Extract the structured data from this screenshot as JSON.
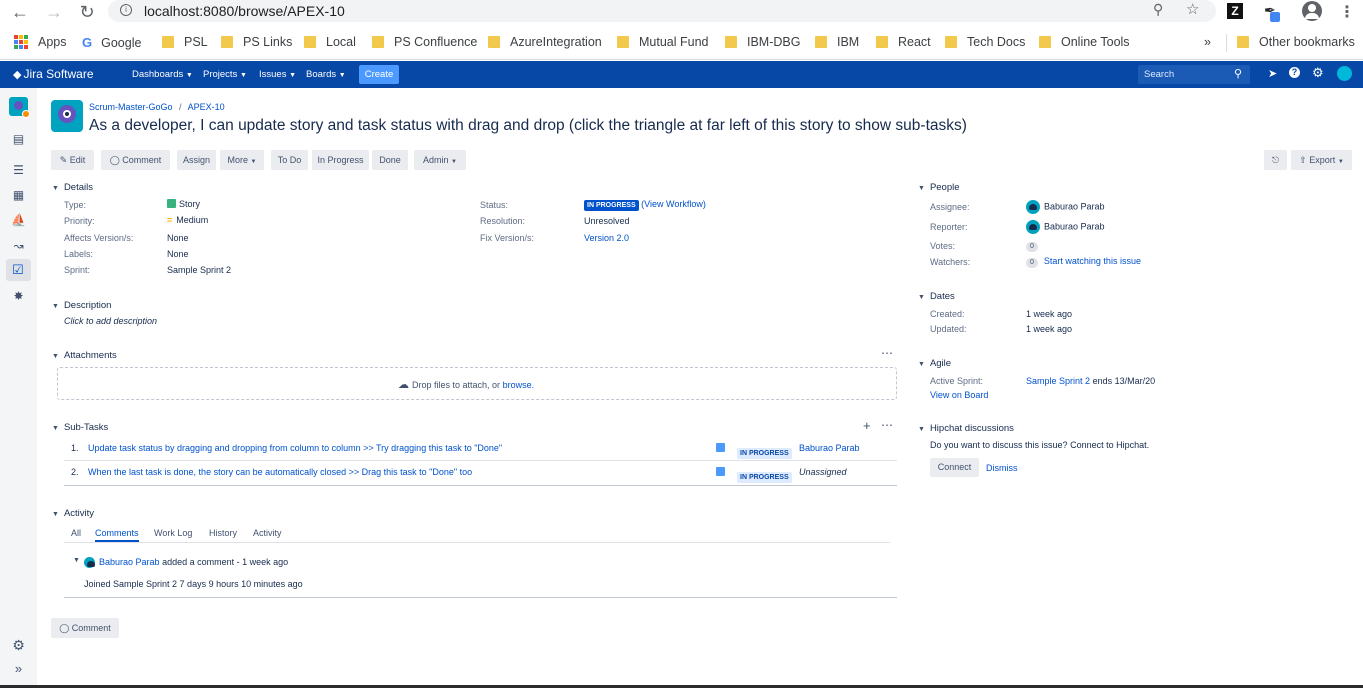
{
  "browser": {
    "url": "localhost:8080/browse/APEX-10",
    "bookmarks": [
      "Apps",
      "Google",
      "PSL",
      "PS Links",
      "Local",
      "PS Confluence",
      "AzureIntegration",
      "Mutual Fund",
      "IBM-DBG",
      "IBM",
      "React",
      "Tech Docs",
      "Online Tools"
    ],
    "other_bookmarks": "Other bookmarks",
    "overflow": "»"
  },
  "jira_nav": {
    "logo": "Jira Software",
    "menus": [
      "Dashboards",
      "Projects",
      "Issues",
      "Boards"
    ],
    "create": "Create",
    "search_placeholder": "Search"
  },
  "issue": {
    "project": "Scrum-Master-GoGo",
    "separator": "/",
    "key": "APEX-10",
    "title": "As a developer, I can update story and task status with drag and drop (click the triangle at far left of this story to show sub-tasks)"
  },
  "toolbar": {
    "edit": "Edit",
    "comment": "Comment",
    "assign": "Assign",
    "more": "More",
    "todo": "To Do",
    "inprogress": "In Progress",
    "done": "Done",
    "admin": "Admin",
    "export": "Export"
  },
  "details": {
    "heading": "Details",
    "type_label": "Type:",
    "type_value": "Story",
    "priority_label": "Priority:",
    "priority_value": "Medium",
    "affects_label": "Affects Version/s:",
    "affects_value": "None",
    "labels_label": "Labels:",
    "labels_value": "None",
    "sprint_label": "Sprint:",
    "sprint_value": "Sample Sprint 2",
    "status_label": "Status:",
    "status_value": "IN PROGRESS",
    "view_workflow": "(View Workflow)",
    "resolution_label": "Resolution:",
    "resolution_value": "Unresolved",
    "fix_label": "Fix Version/s:",
    "fix_value": "Version 2.0"
  },
  "description": {
    "heading": "Description",
    "placeholder": "Click to add description"
  },
  "attachments": {
    "heading": "Attachments",
    "drop_text": "Drop files to attach, or",
    "browse": "browse."
  },
  "subtasks": {
    "heading": "Sub-Tasks",
    "items": [
      {
        "num": "1.",
        "summary": "Update task status by dragging and dropping from column to column >> Try dragging this task to \"Done\"",
        "status": "IN PROGRESS",
        "assignee": "Baburao Parab"
      },
      {
        "num": "2.",
        "summary": "When the last task is done, the story can be automatically closed >> Drag this task to \"Done\" too",
        "status": "IN PROGRESS",
        "assignee": "Unassigned"
      }
    ]
  },
  "activity": {
    "heading": "Activity",
    "tabs": [
      "All",
      "Comments",
      "Work Log",
      "History",
      "Activity"
    ],
    "comment_author": "Baburao Parab",
    "comment_meta": "added a comment - 1 week ago",
    "comment_body": "Joined Sample Sprint 2 7 days 9 hours 10 minutes ago",
    "comment_button": "Comment"
  },
  "people": {
    "heading": "People",
    "assignee_label": "Assignee:",
    "assignee_value": "Baburao Parab",
    "reporter_label": "Reporter:",
    "reporter_value": "Baburao Parab",
    "votes_label": "Votes:",
    "votes_value": "0",
    "watchers_label": "Watchers:",
    "watchers_value": "0",
    "start_watching": "Start watching this issue"
  },
  "dates": {
    "heading": "Dates",
    "created_label": "Created:",
    "created_value": "1 week ago",
    "updated_label": "Updated:",
    "updated_value": "1 week ago"
  },
  "agile": {
    "heading": "Agile",
    "active_label": "Active Sprint:",
    "active_value": "Sample Sprint 2",
    "active_suffix": "ends 13/Mar/20",
    "view_board": "View on Board"
  },
  "hipchat": {
    "heading": "Hipchat discussions",
    "prompt": "Do you want to discuss this issue? Connect to Hipchat.",
    "connect": "Connect",
    "dismiss": "Dismiss"
  },
  "colors": {
    "nav": "#0747a6",
    "link": "#0052cc",
    "lozenge": "#0052cc",
    "create": "#4c9aff"
  }
}
